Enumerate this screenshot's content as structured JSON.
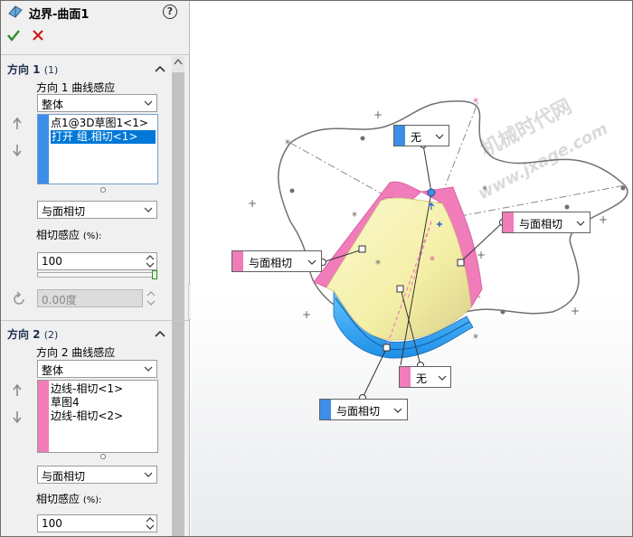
{
  "panel": {
    "title": "边界-曲面1",
    "help": "?",
    "dir1": {
      "title": "方向 1",
      "count": "(1)",
      "curve_label": "方向 1 曲线感应",
      "curve_value": "整体",
      "list": [
        "点1@3D草图1<1>",
        "打开 组.相切<1>"
      ],
      "tangent_value": "与面相切",
      "influence_label": "相切感应",
      "influence_unit": "(%):",
      "influence_value": "100",
      "angle_placeholder": "0.00度"
    },
    "dir2": {
      "title": "方向 2",
      "count": "(2)",
      "curve_label": "方向 2 曲线感应",
      "curve_value": "整体",
      "list": [
        "边线-相切<1>",
        "草图4",
        "边线-相切<2>"
      ],
      "tangent_value": "与面相切",
      "influence_label": "相切感应",
      "influence_unit": "(%):",
      "influence_value": "100"
    }
  },
  "viewport": {
    "callouts": {
      "top_none": "无",
      "right_tangent": "与面相切",
      "left_tangent": "与面相切",
      "bottom_none": "无",
      "bottom_tangent": "与面相切"
    },
    "watermark_cn": "机械时代网",
    "watermark_url": "www.jxage.com"
  },
  "colors": {
    "dir1_stripe": "#3d8ee8",
    "dir2_stripe": "#f07cb9",
    "ok_green": "#2e8b2e",
    "cancel_red": "#d11a1a",
    "list_select": "#0078d7"
  }
}
